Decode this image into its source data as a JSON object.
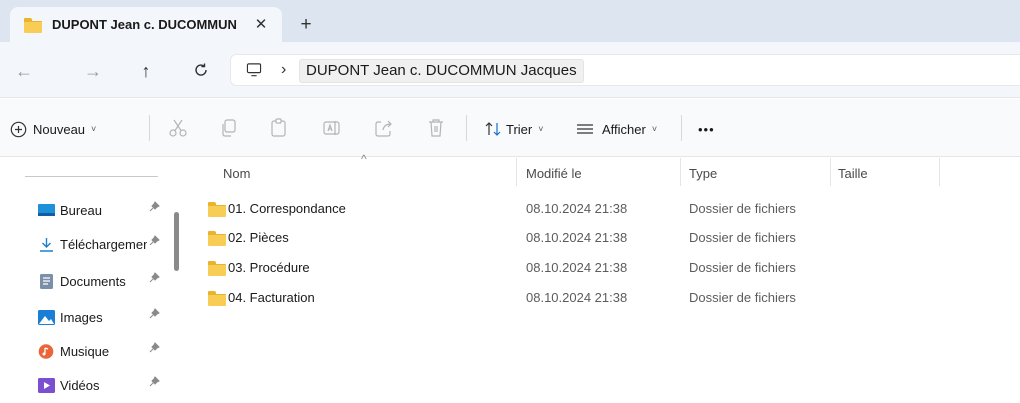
{
  "tab": {
    "title": "DUPONT Jean c. DUCOMMUN",
    "close_glyph": "✕",
    "new_tab_glyph": "+"
  },
  "nav": {
    "back_glyph": "←",
    "forward_glyph": "→",
    "up_glyph": "↑",
    "refresh_glyph": "C",
    "separator": "›",
    "breadcrumb": "DUPONT Jean c. DUCOMMUN Jacques"
  },
  "toolbar": {
    "new_label": "Nouveau",
    "sort_label": "Trier",
    "view_label": "Afficher",
    "more_label": "•••",
    "chevron": "˅"
  },
  "sidebar": {
    "pin_glyph": "📌",
    "items": [
      {
        "label": "Bureau",
        "icon": "desktop-icon",
        "color": "#1e90d8"
      },
      {
        "label": "Téléchargements",
        "icon": "download-icon",
        "color": "#1e7fd0"
      },
      {
        "label": "Documents",
        "icon": "documents-icon",
        "color": "#7b8fa8"
      },
      {
        "label": "Images",
        "icon": "images-icon",
        "color": "#1a7fd4"
      },
      {
        "label": "Musique",
        "icon": "music-icon",
        "color": "#e8663a"
      },
      {
        "label": "Vidéos",
        "icon": "videos-icon",
        "color": "#7b4fcf"
      }
    ]
  },
  "list": {
    "sort_glyph": "^",
    "columns": {
      "name": "Nom",
      "modified": "Modifié le",
      "type": "Type",
      "size": "Taille"
    },
    "rows": [
      {
        "name": "01. Correspondance",
        "modified": "08.10.2024 21:38",
        "type": "Dossier de fichiers",
        "size": ""
      },
      {
        "name": "02. Pièces",
        "modified": "08.10.2024 21:38",
        "type": "Dossier de fichiers",
        "size": ""
      },
      {
        "name": "03. Procédure",
        "modified": "08.10.2024 21:38",
        "type": "Dossier de fichiers",
        "size": ""
      },
      {
        "name": "04. Facturation",
        "modified": "08.10.2024 21:38",
        "type": "Dossier de fichiers",
        "size": ""
      }
    ]
  },
  "colors": {
    "tabstrip": "#dde5f0",
    "folder": "#f7cd55",
    "accent": "#0067c0"
  }
}
